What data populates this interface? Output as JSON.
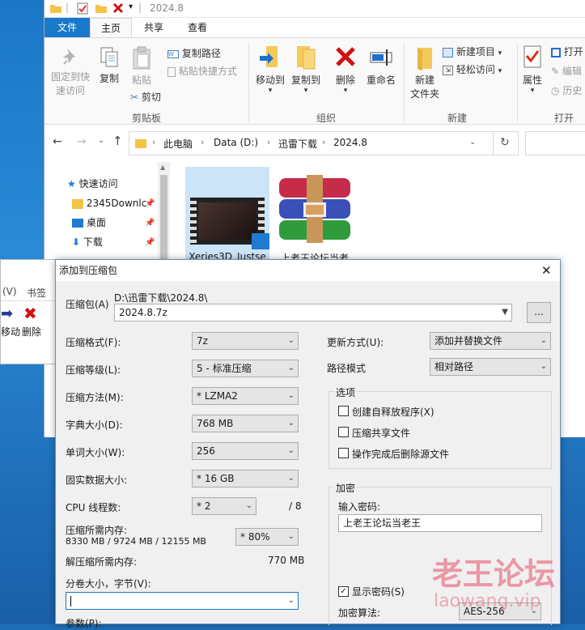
{
  "explorer": {
    "title": "2024.8",
    "tabs": [
      "文件",
      "主页",
      "共享",
      "查看"
    ],
    "ribbon": {
      "pin_label_1": "固定到快",
      "pin_label_2": "速访问",
      "copy": "复制",
      "paste": "粘贴",
      "copy_path": "复制路径",
      "paste_shortcut": "粘贴快捷方式",
      "cut": "剪切",
      "group_clipboard": "剪贴板",
      "move_to": "移动到",
      "copy_to": "复制到",
      "delete": "删除",
      "rename": "重命名",
      "group_organize": "组织",
      "new_folder_1": "新建",
      "new_folder_2": "文件夹",
      "new_item": "新建项目",
      "easy_access": "轻松访问",
      "group_new": "新建",
      "properties": "属性",
      "open": "打开",
      "edit": "编辑",
      "history": "历史",
      "group_open": "打开"
    },
    "breadcrumb": [
      "此电脑",
      "Data (D:)",
      "迅雷下载",
      "2024.8"
    ],
    "nav": [
      {
        "label": "快速访问"
      },
      {
        "label": "2345Downlc"
      },
      {
        "label": "桌面"
      },
      {
        "label": "下载"
      }
    ],
    "files": [
      {
        "name": "Xeries3D_Justse"
      },
      {
        "name": "上老王论坛当老"
      }
    ]
  },
  "old_window": {
    "menu_view": "(V)",
    "menu_bookmark": "书签",
    "move": "移动",
    "delete": "删除"
  },
  "dialog": {
    "title": "添加到压缩包",
    "archive_label": "压缩包(A)",
    "archive_path": "D:\\迅雷下载\\2024.8\\",
    "archive_name": "2024.8.7z",
    "browse": "...",
    "format_label": "压缩格式(F):",
    "format_value": "7z",
    "level_label": "压缩等级(L):",
    "level_value": "5 - 标准压缩",
    "method_label": "压缩方法(M):",
    "method_value": "* LZMA2",
    "dict_label": "字典大小(D):",
    "dict_value": "768 MB",
    "word_label": "单词大小(W):",
    "word_value": "256",
    "solid_label": "固实数据大小:",
    "solid_value": "* 16 GB",
    "threads_label": "CPU 线程数:",
    "threads_value": "* 2",
    "threads_max": "/ 8",
    "mem_label": "压缩所需内存:",
    "mem_values": "8330 MB / 9724 MB / 12155 MB",
    "mem_percent": "* 80%",
    "decomp_label": "解压缩所需内存:",
    "decomp_value": "770 MB",
    "volume_label": "分卷大小，字节(V):",
    "volume_value": "",
    "params_label": "参数(P):",
    "update_label": "更新方式(U):",
    "update_value": "添加并替换文件",
    "pathmode_label": "路径模式",
    "pathmode_value": "相对路径",
    "options_title": "选项",
    "opt_sfx": "创建自释放程序(X)",
    "opt_shared": "压缩共享文件",
    "opt_delete": "操作完成后删除源文件",
    "encrypt_title": "加密",
    "password_label": "输入密码:",
    "password_value": "上老王论坛当老王",
    "show_password": "显示密码(S)",
    "enc_method_label": "加密算法:",
    "enc_method_value": "AES-256"
  },
  "watermark": {
    "line1": "老王论坛",
    "line2": "laowang.vip"
  },
  "colors": {
    "accent": "#1979ca",
    "watermark": "#e8506a"
  }
}
